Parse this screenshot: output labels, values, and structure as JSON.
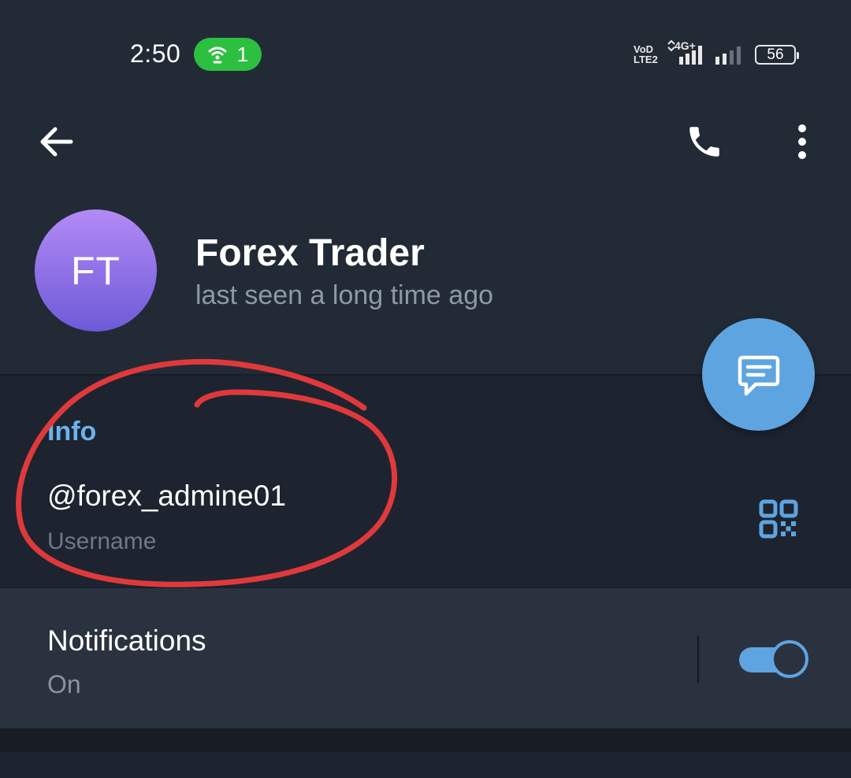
{
  "status_bar": {
    "time": "2:50",
    "hotspot_count": "1",
    "network_label_top": "VoD",
    "network_label_bottom": "LTE2",
    "signal_label": "4G+",
    "battery": "56"
  },
  "toolbar": {
    "back_icon": "arrow-left-icon",
    "call_icon": "phone-icon",
    "more_icon": "more-vertical-icon"
  },
  "profile": {
    "initials": "FT",
    "name": "Forex Trader",
    "status": "last seen a long time ago"
  },
  "info": {
    "title": "Info",
    "username": "@forex_admine01",
    "username_label": "Username"
  },
  "notifications": {
    "title": "Notifications",
    "state": "On",
    "enabled": true
  },
  "colors": {
    "background": "#222a36",
    "accent": "#5ea4e0",
    "annotation": "#e0393b",
    "hotspot": "#2dbf3f"
  }
}
